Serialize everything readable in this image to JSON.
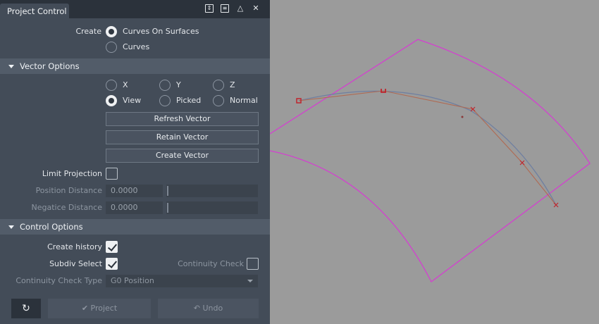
{
  "panel": {
    "tab_title": "Project Control",
    "titlebar_icons": [
      "expand-vertical-icon",
      "menu-icon",
      "collapse-icon",
      "close-icon"
    ]
  },
  "create": {
    "label": "Create",
    "options": [
      {
        "label": "Curves On Surfaces",
        "selected": true
      },
      {
        "label": "Curves",
        "selected": false
      }
    ]
  },
  "vector_options": {
    "title": "Vector Options",
    "radios": [
      {
        "label": "X",
        "selected": false
      },
      {
        "label": "Y",
        "selected": false
      },
      {
        "label": "Z",
        "selected": false
      },
      {
        "label": "View",
        "selected": true
      },
      {
        "label": "Picked",
        "selected": false
      },
      {
        "label": "Normal",
        "selected": false
      }
    ],
    "buttons": [
      "Refresh Vector",
      "Retain Vector",
      "Create Vector"
    ],
    "limit_projection_label": "Limit Projection",
    "limit_projection_checked": false,
    "position_distance_label": "Position Distance",
    "position_distance_value": "0.0000",
    "negative_distance_label": "Negatice Distance",
    "negative_distance_value": "0.0000"
  },
  "control_options": {
    "title": "Control Options",
    "create_history_label": "Create history",
    "create_history_checked": true,
    "subdiv_select_label": "Subdiv Select",
    "subdiv_select_checked": true,
    "continuity_check_label": "Continuity Check",
    "continuity_check_checked": false,
    "continuity_type_label": "Continuity Check Type",
    "continuity_type_value": "G0 Position"
  },
  "actions": {
    "reset_icon": "reset-icon",
    "project_label": "Project",
    "undo_label": "Undo"
  },
  "colors": {
    "surface_outline": "#d43fd0",
    "curve": "#6e7fa1",
    "hull": "#b06a52",
    "cv_marker": "#c0242c"
  }
}
